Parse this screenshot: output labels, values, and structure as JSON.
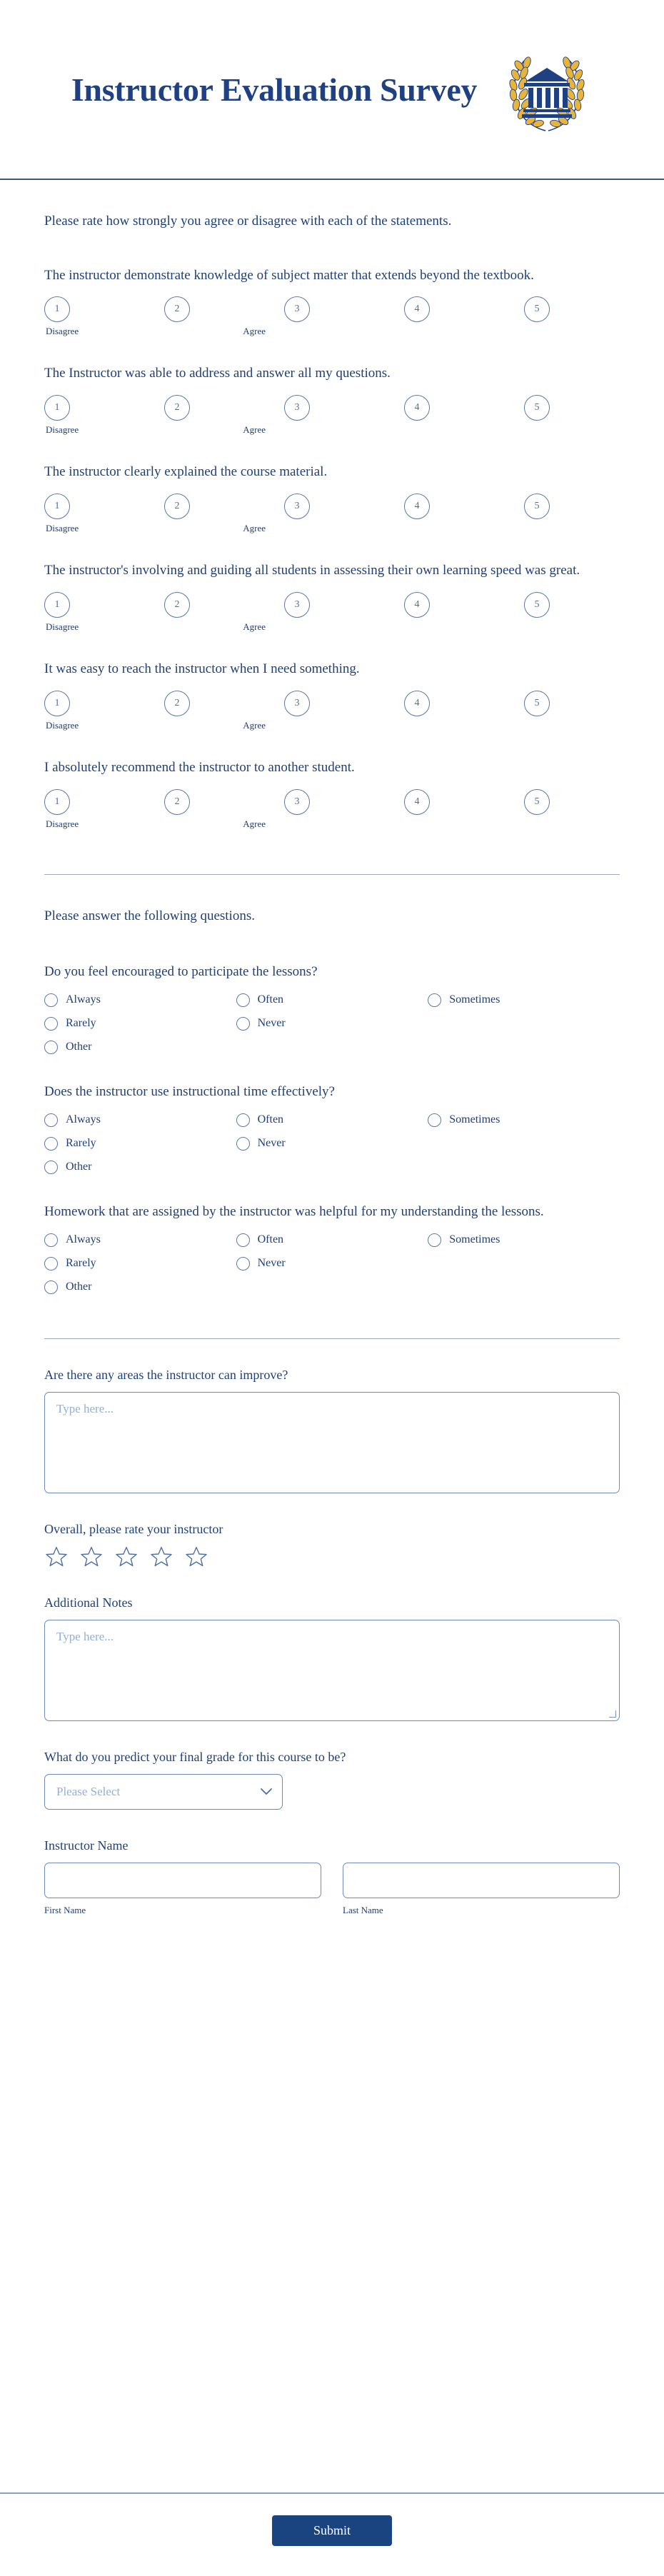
{
  "header": {
    "title": "Instructor Evaluation Survey",
    "logo_icon": "laurel-wreath-university-icon"
  },
  "intro": "Please rate how strongly you agree or disagree with each of the statements.",
  "scale": {
    "options": [
      "1",
      "2",
      "3",
      "4",
      "5"
    ],
    "low_label": "Disagree",
    "high_label": "Agree"
  },
  "scale_questions": [
    {
      "text": "The instructor demonstrate knowledge of subject matter that extends beyond the textbook."
    },
    {
      "text": "The Instructor was able to address and answer all my questions."
    },
    {
      "text": "The instructor clearly explained the course material."
    },
    {
      "text": "The instructor's involving and guiding all students in assessing their own learning speed was great."
    },
    {
      "text": "It was easy to reach the instructor when I need something."
    },
    {
      "text": "I absolutely recommend the instructor to another student."
    }
  ],
  "section_two_heading": "Please answer the following questions.",
  "radio_options": {
    "col1": [
      "Always",
      "Rarely",
      "Other"
    ],
    "col2": [
      "Often",
      "Never"
    ],
    "col3": [
      "Sometimes"
    ]
  },
  "radio_questions": [
    {
      "text": "Do you feel encouraged to participate the lessons?"
    },
    {
      "text": "Does the instructor use instructional time effectively?"
    },
    {
      "text": "Homework that are assigned by the instructor was helpful for my understanding the lessons."
    }
  ],
  "improve": {
    "label": "Are there any areas the instructor can improve?",
    "placeholder": "Type here...",
    "value": ""
  },
  "overall_rating": {
    "label": "Overall, please rate your instructor",
    "stars_total": 5,
    "stars_selected": 0,
    "star_icon": "star-outline-icon"
  },
  "additional_notes": {
    "label": "Additional Notes",
    "placeholder": "Type here...",
    "value": ""
  },
  "final_grade": {
    "label": "What do you predict your final grade for this course to be?",
    "selected": "Please Select",
    "chevron_icon": "chevron-down-icon"
  },
  "instructor_name": {
    "label": "Instructor Name",
    "first": {
      "value": "",
      "placeholder": "",
      "sub_label": "First Name"
    },
    "last": {
      "value": "",
      "placeholder": "",
      "sub_label": "Last Name"
    }
  },
  "footer": {
    "submit_label": "Submit"
  },
  "colors": {
    "brand_blue": "#1f4182",
    "text_blue": "#20407a",
    "border_blue": "#6d8cb8",
    "placeholder_blue": "#8fb0dd",
    "logo_gold": "#e8b43c",
    "submit_bg": "#1a4480"
  }
}
